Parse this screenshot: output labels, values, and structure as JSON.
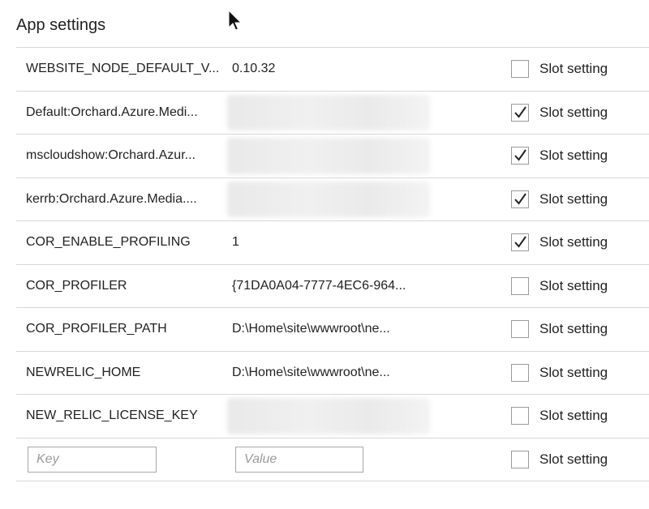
{
  "section": {
    "title": "App settings"
  },
  "slot_label": "Slot setting",
  "rows": [
    {
      "key": "WEBSITE_NODE_DEFAULT_V...",
      "value": "0.10.32",
      "blurred": false,
      "slot_checked": false
    },
    {
      "key": "Default:Orchard.Azure.Medi...",
      "value": "",
      "blurred": true,
      "slot_checked": true
    },
    {
      "key": "mscloudshow:Orchard.Azur...",
      "value": "",
      "blurred": true,
      "slot_checked": true
    },
    {
      "key": "kerrb:Orchard.Azure.Media....",
      "value": "",
      "blurred": true,
      "slot_checked": true
    },
    {
      "key": "COR_ENABLE_PROFILING",
      "value": "1",
      "blurred": false,
      "slot_checked": true
    },
    {
      "key": "COR_PROFILER",
      "value": "{71DA0A04-7777-4EC6-964...",
      "blurred": false,
      "slot_checked": false
    },
    {
      "key": "COR_PROFILER_PATH",
      "value": "D:\\Home\\site\\wwwroot\\ne...",
      "blurred": false,
      "slot_checked": false
    },
    {
      "key": "NEWRELIC_HOME",
      "value": "D:\\Home\\site\\wwwroot\\ne...",
      "blurred": false,
      "slot_checked": false
    },
    {
      "key": "NEW_RELIC_LICENSE_KEY",
      "value": "",
      "blurred": true,
      "slot_checked": false
    }
  ],
  "new_row": {
    "key_placeholder": "Key",
    "value_placeholder": "Value",
    "slot_checked": false
  },
  "icons": {
    "cursor": "mouse-pointer-icon",
    "check": "checkmark-icon"
  }
}
